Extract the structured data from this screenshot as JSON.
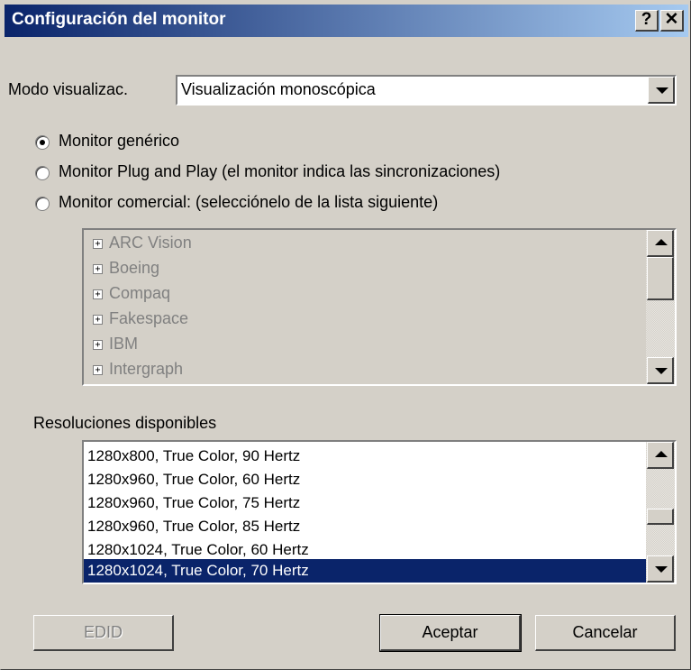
{
  "window": {
    "title": "Configuración del monitor",
    "help_label": "?",
    "close_label": "✕"
  },
  "display_mode": {
    "label": "Modo visualizac.",
    "value": "Visualización monoscópica"
  },
  "monitor_options": [
    {
      "label": "Monitor genérico",
      "checked": true
    },
    {
      "label": "Monitor Plug and Play (el monitor indica las sincronizaciones)",
      "checked": false
    },
    {
      "label": "Monitor comercial: (selecciónelo de la lista siguiente)",
      "checked": false
    }
  ],
  "vendors": [
    "ARC Vision",
    "Boeing",
    "Compaq",
    "Fakespace",
    "IBM",
    "Intergraph"
  ],
  "resolutions": {
    "label": "Resoluciones disponibles",
    "items": [
      "1280x800, True Color, 90 Hertz",
      "1280x960, True Color, 60 Hertz",
      "1280x960, True Color, 75 Hertz",
      "1280x960, True Color, 85 Hertz",
      "1280x1024, True Color, 60 Hertz",
      "1280x1024, True Color, 70 Hertz"
    ],
    "selected": "1280x1024, True Color, 70 Hertz"
  },
  "buttons": {
    "edid": "EDID",
    "accept": "Aceptar",
    "cancel": "Cancelar"
  },
  "colors": {
    "title_gradient_start": "#0a246a",
    "title_gradient_end": "#a6caf0",
    "selection": "#0a246a",
    "face": "#d4d0c8"
  }
}
